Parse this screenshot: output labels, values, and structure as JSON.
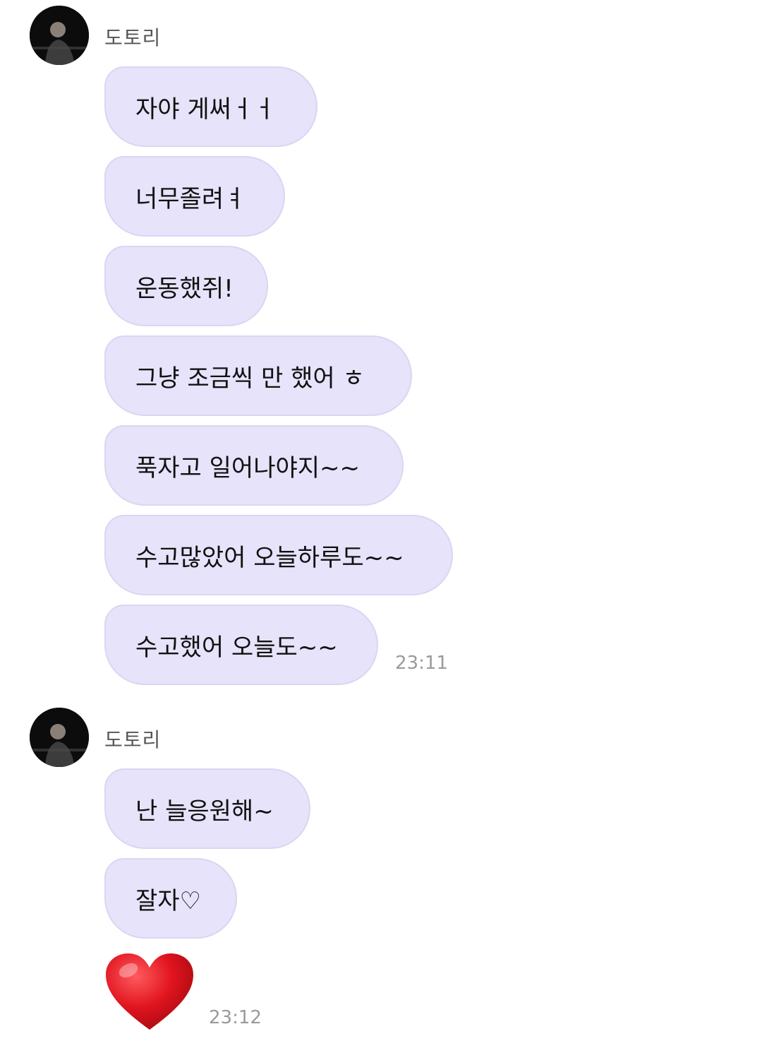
{
  "groups": [
    {
      "sender": "도토리",
      "messages": [
        "자야 게써ㅓㅓ",
        "너무졸려ㅕ",
        "운동했쥐!",
        "그냥 조금씩 만 했어 ㅎ",
        "푹자고 일어나야지~~",
        "수고많았어 오늘하루도~~",
        "수고했어 오늘도~~"
      ],
      "time": "23:11"
    },
    {
      "sender": "도토리",
      "messages": [
        "난 늘응원해~",
        "잘자♡"
      ],
      "emoji": "red-heart",
      "time": "23:12"
    }
  ],
  "colors": {
    "bubble": "#e6e3fa",
    "bubble_border": "#dad6f2",
    "time_text": "#9a9a9a",
    "sender_text": "#555555",
    "heart": "#e0141e"
  }
}
